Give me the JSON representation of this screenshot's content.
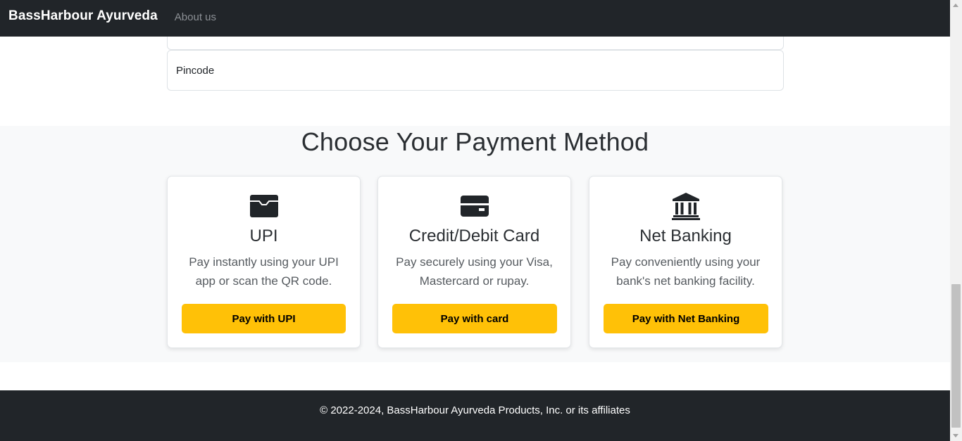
{
  "navbar": {
    "brand": "BassHarbour Ayurveda",
    "links": [
      "About us"
    ]
  },
  "form": {
    "pincode_placeholder": "Pincode"
  },
  "payment": {
    "title": "Choose Your Payment Method",
    "accent_color": "#ffc107",
    "methods": [
      {
        "icon": "wallet-icon",
        "title": "UPI",
        "description": "Pay instantly using your UPI app or scan the QR code.",
        "button": "Pay with UPI"
      },
      {
        "icon": "credit-card-icon",
        "title": "Credit/Debit Card",
        "description": "Pay securely using your Visa, Mastercard or rupay.",
        "button": "Pay with card"
      },
      {
        "icon": "bank-icon",
        "title": "Net Banking",
        "description": "Pay conveniently using your bank's net banking facility.",
        "button": "Pay with Net Banking"
      }
    ]
  },
  "footer": {
    "text": "© 2022-2024, BassHarbour Ayurveda Products, Inc. or its affiliates"
  }
}
